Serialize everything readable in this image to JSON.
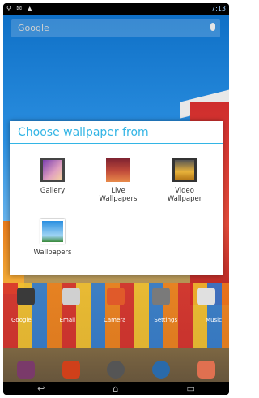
{
  "status_bar": {
    "time": "7:13"
  },
  "search": {
    "placeholder": "Google"
  },
  "dialog": {
    "title": "Choose wallpaper from",
    "options": [
      {
        "label": "Gallery",
        "icon": "gallery-icon"
      },
      {
        "label": "Live\nWallpapers",
        "icon": "live-wallpapers-icon"
      },
      {
        "label": "Video\nWallpaper",
        "icon": "video-wallpaper-icon"
      },
      {
        "label": "Wallpapers",
        "icon": "wallpapers-icon"
      }
    ]
  },
  "home_apps": [
    "Google",
    "Email",
    "Camera",
    "Settings",
    "Music"
  ],
  "colors": {
    "accent": "#33b5e5"
  }
}
